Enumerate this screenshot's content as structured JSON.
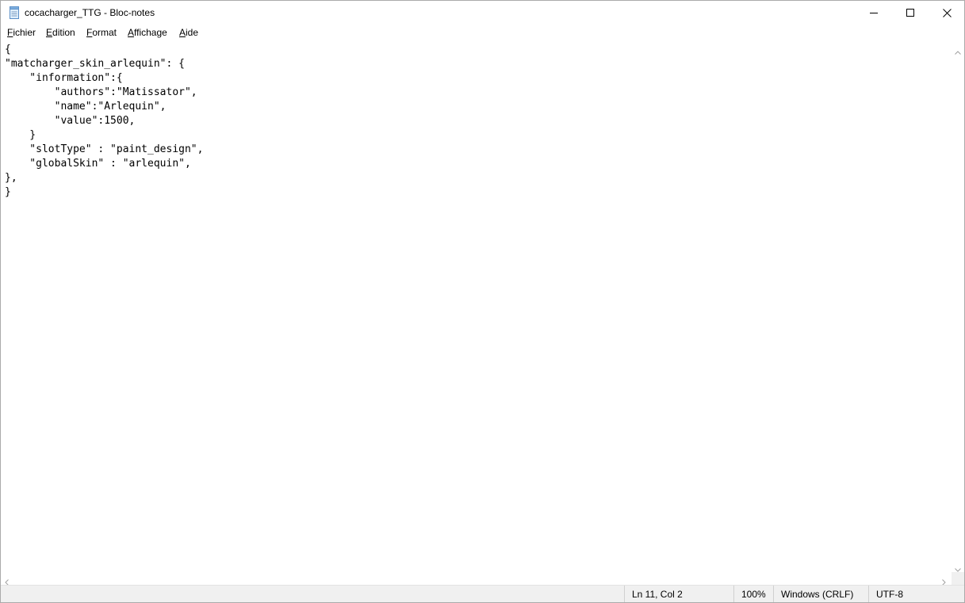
{
  "window": {
    "title": "cocacharger_TTG - Bloc-notes"
  },
  "menu": {
    "items": [
      {
        "first": "F",
        "rest": "ichier"
      },
      {
        "first": "E",
        "rest": "dition"
      },
      {
        "first": "F",
        "rest": "ormat"
      },
      {
        "first": "A",
        "rest": "ffichage"
      },
      {
        "first": "A",
        "rest": "ide"
      }
    ]
  },
  "editor": {
    "content": "{\n\"matcharger_skin_arlequin\": {\n    \"information\":{\n        \"authors\":\"Matissator\",\n        \"name\":\"Arlequin\",\n        \"value\":1500,\n    }\n    \"slotType\" : \"paint_design\",\n    \"globalSkin\" : \"arlequin\",\n},\n}"
  },
  "status": {
    "position": "Ln 11, Col 2",
    "zoom": "100%",
    "line_ending": "Windows (CRLF)",
    "encoding": "UTF-8"
  },
  "icons": {
    "app": "notepad-icon",
    "minimize": "minimize-icon",
    "maximize": "maximize-icon",
    "close": "close-icon"
  }
}
